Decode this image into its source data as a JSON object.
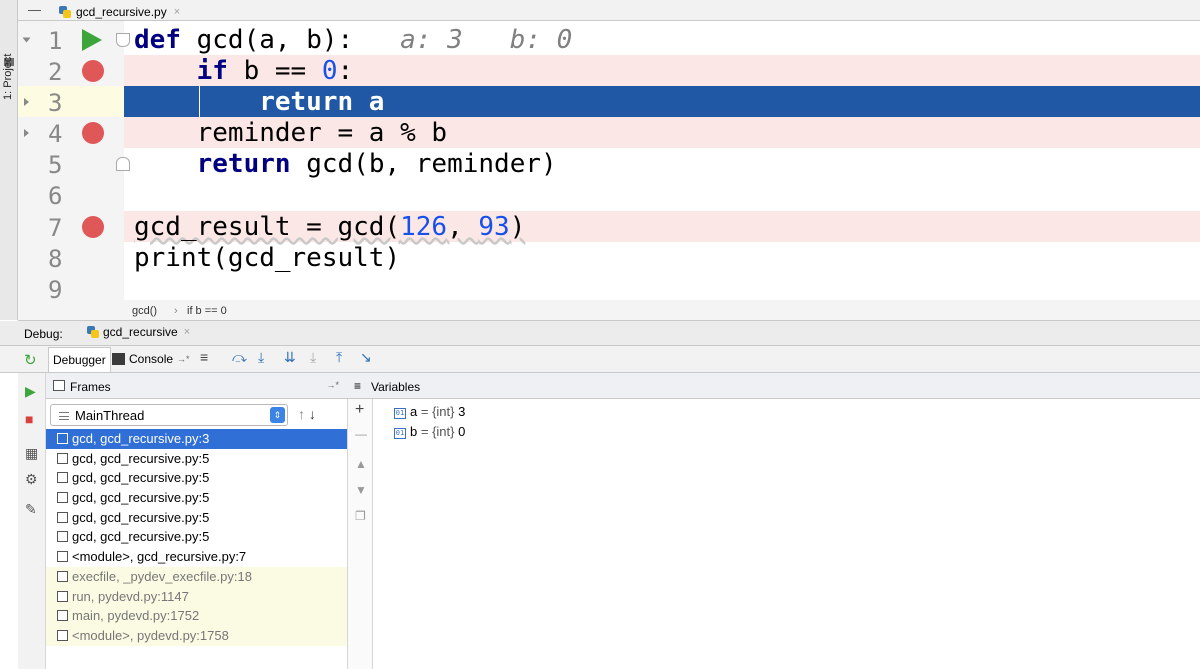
{
  "project_strip": {
    "label": "1: Project"
  },
  "editor_tab": {
    "filename": "gcd_recursive.py",
    "close": "×"
  },
  "editor": {
    "lines": [
      {
        "num": "1"
      },
      {
        "num": "2"
      },
      {
        "num": "3"
      },
      {
        "num": "4"
      },
      {
        "num": "5"
      },
      {
        "num": "6"
      },
      {
        "num": "7"
      },
      {
        "num": "8"
      },
      {
        "num": "9"
      }
    ],
    "code": {
      "l1_kw": "def",
      "l1_rest": " gcd(a, b):",
      "l1_hint": "   a: 3   b: 0",
      "l2_indent": "    ",
      "l2_kw": "if",
      "l2_rest": " b == ",
      "l2_num": "0",
      "l2_tail": ":",
      "l3_text": "        return a",
      "l4_text": "    reminder = a % b",
      "l5_indent": "    ",
      "l5_kw": "return",
      "l5_rest": " gcd(b, reminder)",
      "l7_pre": "gcd_result = gcd(",
      "l7_n1": "126",
      "l7_mid": ", ",
      "l7_n2": "93",
      "l7_post": ")",
      "l8_text": "print(gcd_result)"
    }
  },
  "breadcrumb": {
    "func": "gcd()",
    "sep": "›",
    "cond": "if b == 0"
  },
  "debug_header": {
    "label": "Debug:",
    "session": "gcd_recursive",
    "close": "×"
  },
  "toolbar": {
    "debugger_tab": "Debugger",
    "console_tab": "Console",
    "console_suffix": "→*"
  },
  "frames": {
    "title": "Frames",
    "pin": "→*",
    "thread": "MainThread",
    "items": [
      {
        "label": "gcd, gcd_recursive.py:3"
      },
      {
        "label": "gcd, gcd_recursive.py:5"
      },
      {
        "label": "gcd, gcd_recursive.py:5"
      },
      {
        "label": "gcd, gcd_recursive.py:5"
      },
      {
        "label": "gcd, gcd_recursive.py:5"
      },
      {
        "label": "gcd, gcd_recursive.py:5"
      },
      {
        "label": "<module>, gcd_recursive.py:7"
      },
      {
        "label": "execfile, _pydev_execfile.py:18"
      },
      {
        "label": "run, pydevd.py:1147"
      },
      {
        "label": "main, pydevd.py:1752"
      },
      {
        "label": "<module>, pydevd.py:1758"
      }
    ]
  },
  "variables": {
    "title": "Variables",
    "items": [
      {
        "badge": "01",
        "name": "a",
        "eq": " = ",
        "type": "{int}",
        "value": " 3"
      },
      {
        "badge": "01",
        "name": "b",
        "eq": " = ",
        "type": "{int}",
        "value": " 0"
      }
    ]
  },
  "colors": {
    "current_line": "#2158a6",
    "breakpoint": "#e05757",
    "breakpoint_line": "#fbe8e6",
    "selected_frame": "#2f6fd6",
    "keyword": "#000080",
    "number": "#1750eb"
  }
}
